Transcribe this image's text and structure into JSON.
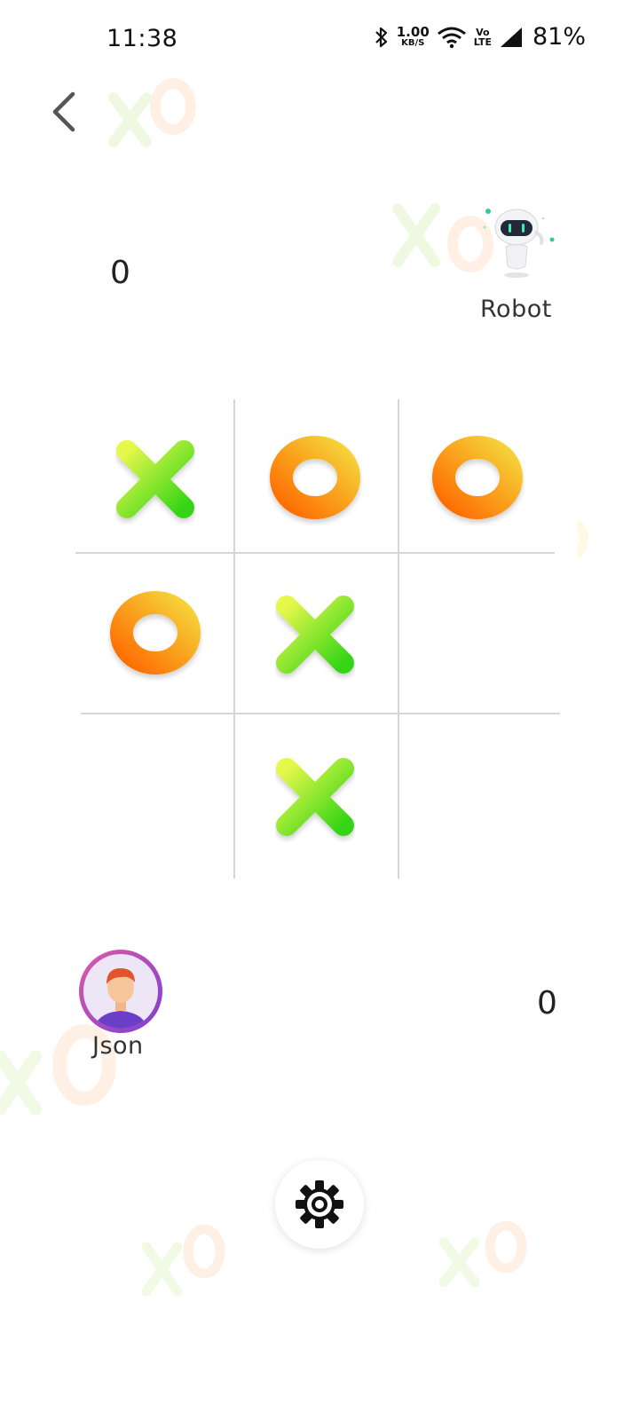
{
  "status_bar": {
    "time": "11:38",
    "net_speed_value": "1.00",
    "net_speed_unit": "KB/S",
    "volte_top": "Vo",
    "volte_bottom": "LTE",
    "battery": "81%",
    "icons": [
      "bluetooth-icon",
      "wifi-icon",
      "signal-icon"
    ]
  },
  "header": {
    "back_icon": "chevron-left-icon"
  },
  "players": {
    "robot": {
      "name": "Robot",
      "score": "0",
      "avatar": "robot-avatar"
    },
    "human": {
      "name": "Json",
      "score": "0",
      "avatar": "human-avatar"
    }
  },
  "board": {
    "cells": [
      "X",
      "O",
      "O",
      "O",
      "X",
      "",
      "",
      "X",
      ""
    ]
  },
  "footer": {
    "settings_icon": "gear-icon"
  },
  "colors": {
    "x_gradient": [
      "#e6f84a",
      "#34d516"
    ],
    "o_gradient": [
      "#f5d63a",
      "#ff6a00"
    ],
    "grid": "#d6d6d6"
  }
}
